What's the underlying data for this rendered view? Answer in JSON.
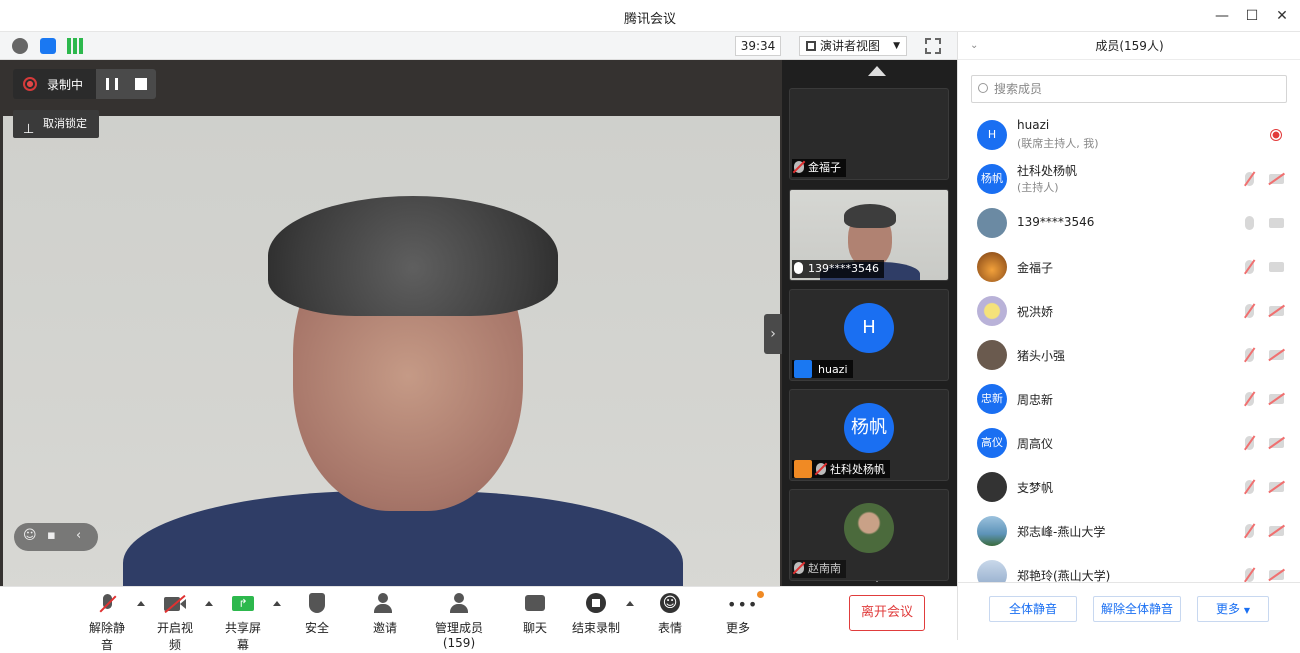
{
  "window": {
    "title": "腾讯会议",
    "minimize": "—",
    "maximize": "☐",
    "close": "✕"
  },
  "topbar": {
    "timer": "39:34",
    "view_label": "演讲者视图"
  },
  "recording": {
    "label": "录制中"
  },
  "unpin": {
    "label": "取消锁定"
  },
  "tiles": [
    {
      "name": "金福子"
    },
    {
      "name": "139****3546"
    },
    {
      "name": "huazi",
      "avatar": "H"
    },
    {
      "name": "社科处杨帆",
      "avatar": "杨帆"
    },
    {
      "name": "赵南南"
    }
  ],
  "bottom": {
    "unmute": "解除静音",
    "start_video": "开启视频",
    "share_screen": "共享屏幕",
    "security": "安全",
    "invite": "邀请",
    "manage_members": "管理成员(159)",
    "chat": "聊天",
    "end_recording": "结束录制",
    "reactions": "表情",
    "more": "更多",
    "leave": "离开会议"
  },
  "panel": {
    "title": "成员(159人)",
    "search_placeholder": "搜索成员",
    "members": [
      {
        "name": "huazi",
        "role": "(联席主持人, 我)",
        "avatar": "H",
        "color": "#1a6ff2"
      },
      {
        "name": "社科处杨帆",
        "role": "(主持人)",
        "avatar": "杨帆",
        "color": "#1a6ff2"
      },
      {
        "name": "139****3546",
        "role": "",
        "avatar": "",
        "color": "#6b8aa3"
      },
      {
        "name": "金福子",
        "role": "",
        "avatar": "",
        "color": "#d07a2a"
      },
      {
        "name": "祝洪娇",
        "role": "",
        "avatar": "",
        "color": "#b9b2d8"
      },
      {
        "name": "猪头小强",
        "role": "",
        "avatar": "",
        "color": "#6a5a4e"
      },
      {
        "name": "周忠新",
        "role": "",
        "avatar": "忠新",
        "color": "#1a6ff2"
      },
      {
        "name": "周高仪",
        "role": "",
        "avatar": "高仪",
        "color": "#1a6ff2"
      },
      {
        "name": "支梦帆",
        "role": "",
        "avatar": "",
        "color": "#333333"
      },
      {
        "name": "郑志峰-燕山大学",
        "role": "",
        "avatar": "",
        "color": "#5d93b8"
      },
      {
        "name": "郑艳玲(燕山大学)",
        "role": "",
        "avatar": "",
        "color": "#8fa9c9"
      }
    ],
    "mute_all": "全体静音",
    "unmute_all": "解除全体静音",
    "more": "更多"
  }
}
